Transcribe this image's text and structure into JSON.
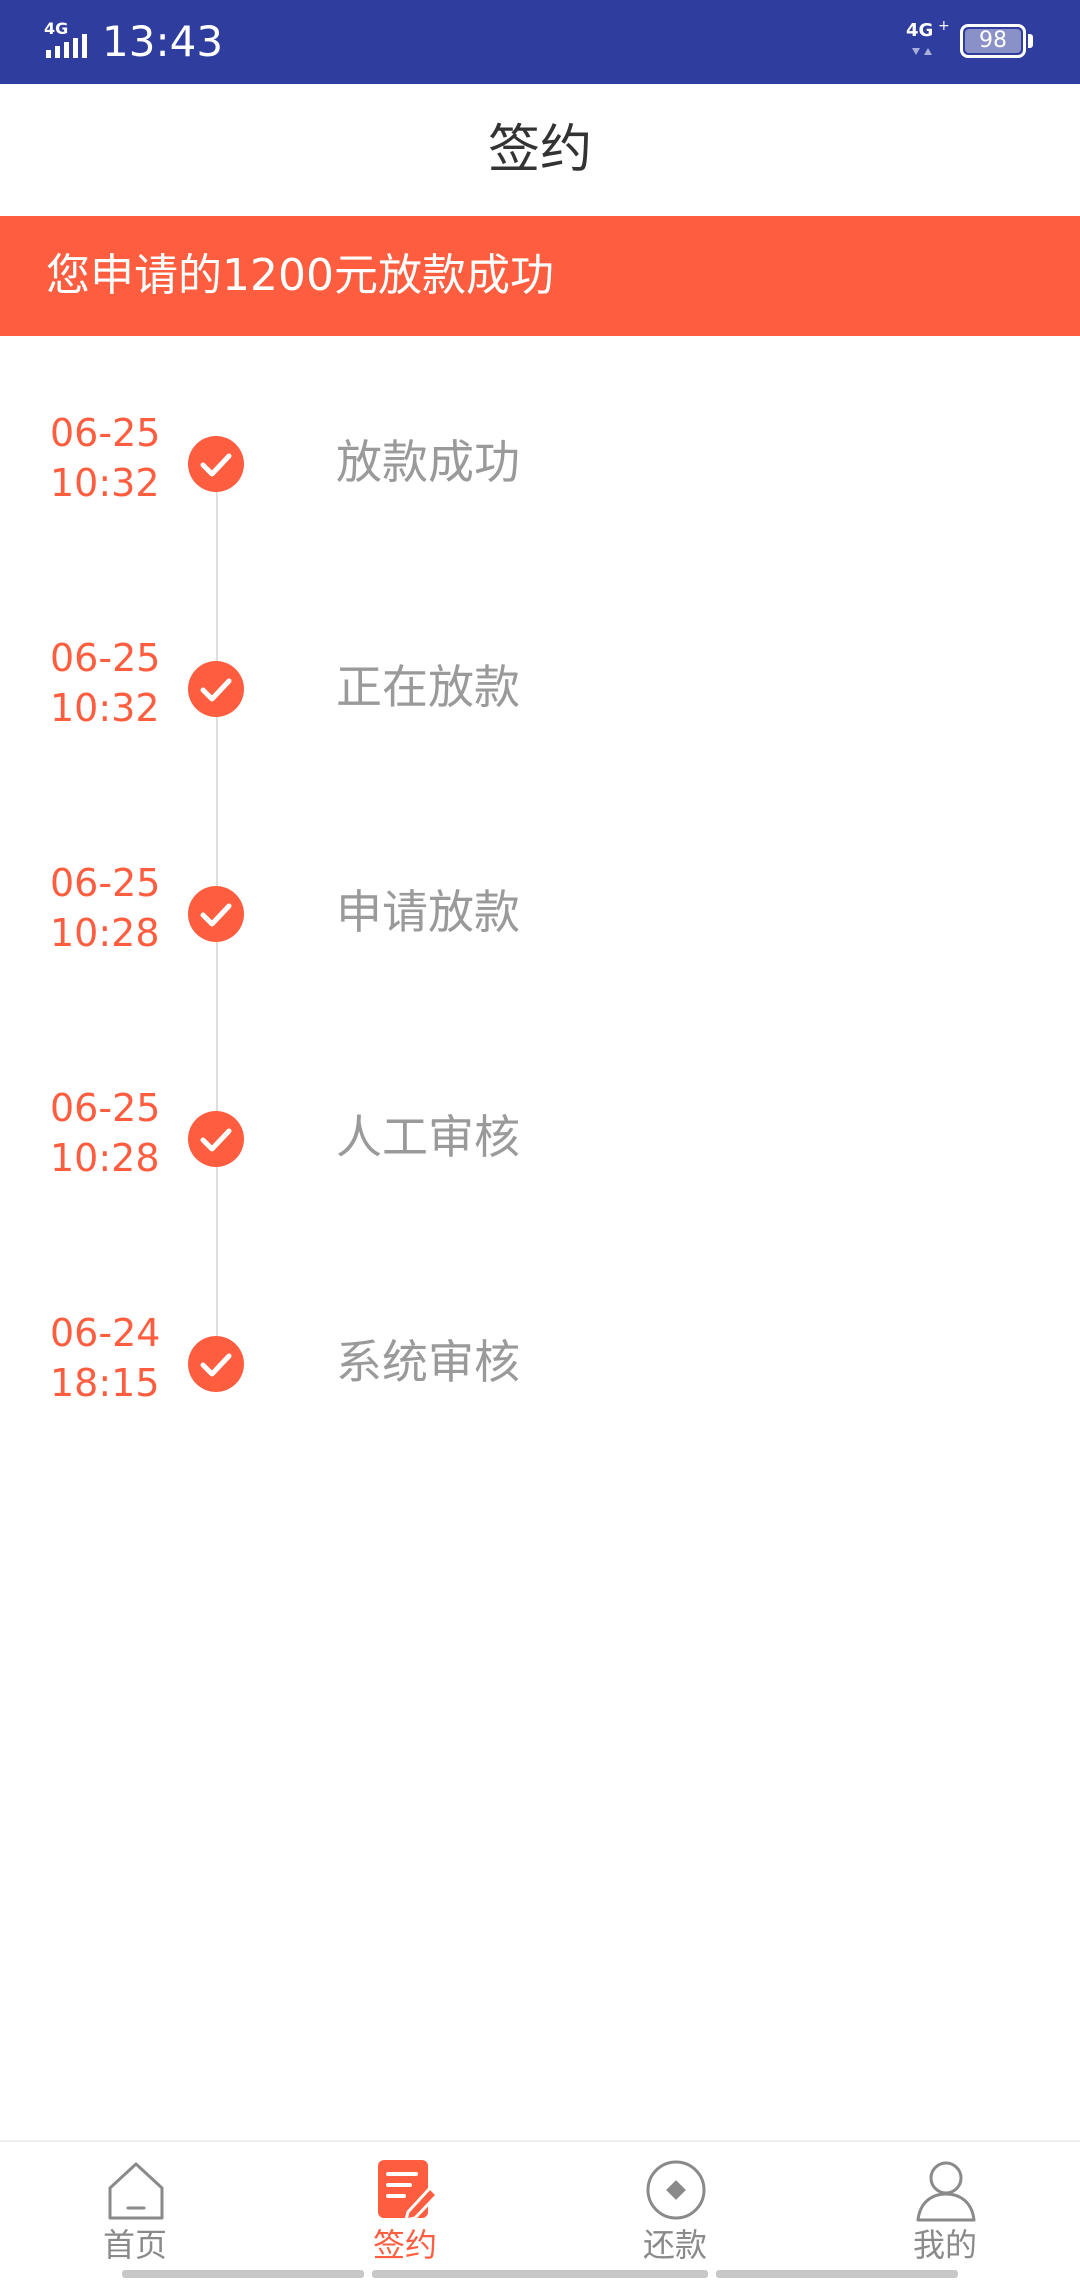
{
  "status_bar": {
    "network_left": "4G",
    "time": "13:43",
    "network_right": "4G",
    "battery": "98"
  },
  "header": {
    "title": "签约"
  },
  "banner": {
    "message": "您申请的1200元放款成功"
  },
  "timeline": [
    {
      "date": "06-25",
      "time": "10:32",
      "label": "放款成功"
    },
    {
      "date": "06-25",
      "time": "10:32",
      "label": "正在放款"
    },
    {
      "date": "06-25",
      "time": "10:28",
      "label": "申请放款"
    },
    {
      "date": "06-25",
      "time": "10:28",
      "label": "人工审核"
    },
    {
      "date": "06-24",
      "time": "18:15",
      "label": "系统审核"
    }
  ],
  "tabs": [
    {
      "label": "首页",
      "icon": "home-icon",
      "active": false
    },
    {
      "label": "签约",
      "icon": "sign-icon",
      "active": true
    },
    {
      "label": "还款",
      "icon": "repay-icon",
      "active": false
    },
    {
      "label": "我的",
      "icon": "profile-icon",
      "active": false
    }
  ],
  "colors": {
    "accent": "#ff5d3f",
    "status_bar": "#2f3d9f",
    "muted_text": "#9a9a9a"
  }
}
